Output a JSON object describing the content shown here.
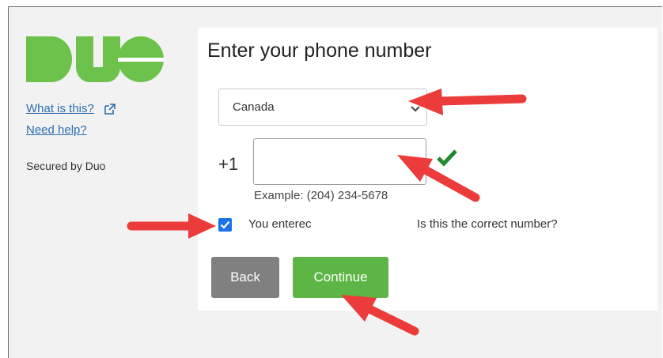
{
  "sidebar": {
    "logo_text": "DUO",
    "what_is_this": "What is this?",
    "need_help": "Need help?",
    "secured_by": "Secured by Duo"
  },
  "form": {
    "title": "Enter your phone number",
    "country": "Canada",
    "country_code": "+1",
    "phone_value": "",
    "phone_example": "Example: (204) 234-5678",
    "confirm_checked": true,
    "confirm_text_start": "You enterec",
    "confirm_text_end": "Is this the correct number?"
  },
  "buttons": {
    "back": "Back",
    "continue": "Continue"
  },
  "colors": {
    "duo_green": "#6cc24a",
    "continue_green": "#5cb544",
    "back_gray": "#808080",
    "check_green": "#1f8a2e",
    "checkbox_blue": "#1a73e8",
    "annotation_red": "#ec3b3b"
  },
  "icons": {
    "external_link": "external-link-icon",
    "dropdown": "chevron-down-icon",
    "valid": "checkmark-icon",
    "annotation": "arrow-annotation"
  }
}
